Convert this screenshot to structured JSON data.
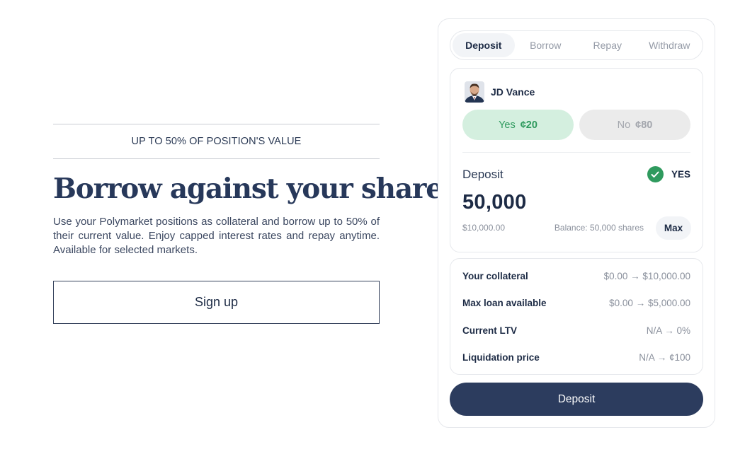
{
  "hero": {
    "eyebrow": "UP TO 50% OF POSITION'S VALUE",
    "headline": "Borrow against your shares",
    "description": "Use your Polymarket positions as collateral and borrow up to 50% of their current value. Enjoy capped interest rates and repay anytime. Available for selected markets.",
    "signup_label": "Sign up"
  },
  "tabs": [
    {
      "label": "Deposit",
      "active": true
    },
    {
      "label": "Borrow",
      "active": false
    },
    {
      "label": "Repay",
      "active": false
    },
    {
      "label": "Withdraw",
      "active": false
    }
  ],
  "market": {
    "name": "JD Vance",
    "avatar_icon": "person-avatar",
    "outcomes": {
      "yes": {
        "label": "Yes",
        "price": "¢20",
        "selected": true
      },
      "no": {
        "label": "No",
        "price": "¢80",
        "selected": false
      }
    }
  },
  "deposit": {
    "label": "Deposit",
    "side_label": "YES",
    "side_icon": "check-circle-icon",
    "amount": "50,000",
    "usd_value": "$10,000.00",
    "balance": "Balance: 50,000 shares",
    "max_label": "Max"
  },
  "stats": [
    {
      "label": "Your collateral",
      "value": "$0.00 → $10,000.00"
    },
    {
      "label": "Max loan available",
      "value": "$0.00 → $5,000.00"
    },
    {
      "label": "Current LTV",
      "value": "N/A → 0%"
    },
    {
      "label": "Liquidation price",
      "value": "N/A → ¢100"
    }
  ],
  "action_button": "Deposit",
  "colors": {
    "primary": "#2c3c5e",
    "yes_bg": "#d4efdf",
    "yes_text": "#2f9a5e",
    "no_bg": "#ebebeb",
    "text_dark": "#1d2b45",
    "text_muted": "#8a909c"
  }
}
